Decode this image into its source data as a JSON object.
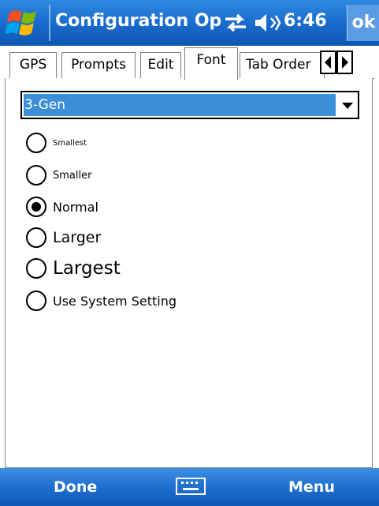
{
  "title_bar": {
    "title": "Configuration Options",
    "time": "6:46",
    "ok_label": "ok",
    "icons": [
      "windows-start-flag-icon",
      "connectivity-icon",
      "volume-icon"
    ]
  },
  "tabs": {
    "items": [
      {
        "label": "GPS"
      },
      {
        "label": "Prompts"
      },
      {
        "label": "Edit"
      },
      {
        "label": "Font"
      },
      {
        "label": "Tab Order"
      }
    ],
    "active": "Font"
  },
  "font_select": {
    "value": "3-Gen"
  },
  "font_sizes": {
    "options": [
      {
        "label": "Smallest",
        "checked": false
      },
      {
        "label": "Smaller",
        "checked": false
      },
      {
        "label": "Normal",
        "checked": true
      },
      {
        "label": "Larger",
        "checked": false
      },
      {
        "label": "Largest",
        "checked": false
      },
      {
        "label": "Use System Setting",
        "checked": false
      }
    ]
  },
  "menu_bar": {
    "left_softkey": "Done",
    "right_softkey": "Menu",
    "center_icon": "keyboard-icon"
  },
  "colors": {
    "title_bar": "#1b6fd0",
    "selection": "#3b8ed8",
    "menu_bar": "#1e6fd0"
  }
}
